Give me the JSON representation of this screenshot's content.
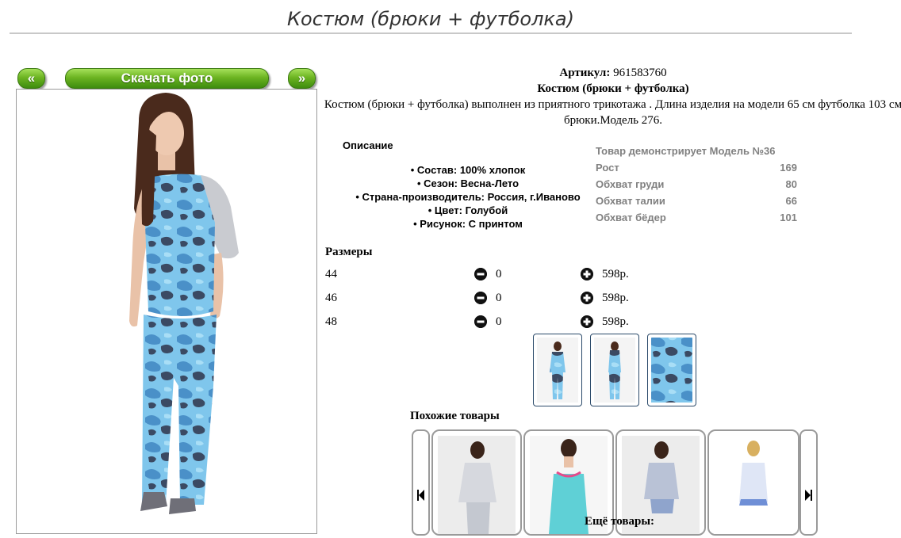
{
  "page": {
    "title": "Костюм (брюки + футболка)"
  },
  "nav": {
    "prev_label": "«",
    "download_label": "Скачать фото",
    "next_label": "»"
  },
  "product": {
    "article_label": "Артикул:",
    "article_value": "961583760",
    "name": "Костюм (брюки + футболка)",
    "description": "Костюм (брюки + футболка) выполнен из приятного трикотажа . Длина изделия на модели 65 см футболка 103 см брюки.Модель 276."
  },
  "description_section": {
    "title": "Описание",
    "properties": [
      "• Состав: 100% хлопок",
      "• Сезон: Весна-Лето",
      "• Страна-производитель: Россия, г.Иваново",
      "• Цвет: Голубой",
      "• Рисунок: С принтом"
    ]
  },
  "model": {
    "heading": "Товар демонстрирует Модель №36",
    "rows": [
      {
        "label": "Рост",
        "value": "169"
      },
      {
        "label": "Обхват груди",
        "value": "80"
      },
      {
        "label": "Обхват талии",
        "value": "66"
      },
      {
        "label": "Обхват бёдер",
        "value": "101"
      }
    ]
  },
  "sizes": {
    "title": "Размеры",
    "rows": [
      {
        "size": "44",
        "qty": "0",
        "price": "598р."
      },
      {
        "size": "46",
        "qty": "0",
        "price": "598р."
      },
      {
        "size": "48",
        "qty": "0",
        "price": "598р."
      }
    ]
  },
  "similar": {
    "title": "Похожие товары"
  },
  "more": {
    "title": "Ещё товары:"
  },
  "colors": {
    "camo_light": "#7fc6ec",
    "camo_mid": "#4a90c8",
    "camo_dark": "#3b4a63",
    "sleeve_grey": "#c9cbd0",
    "button_green": "#6cb422"
  }
}
